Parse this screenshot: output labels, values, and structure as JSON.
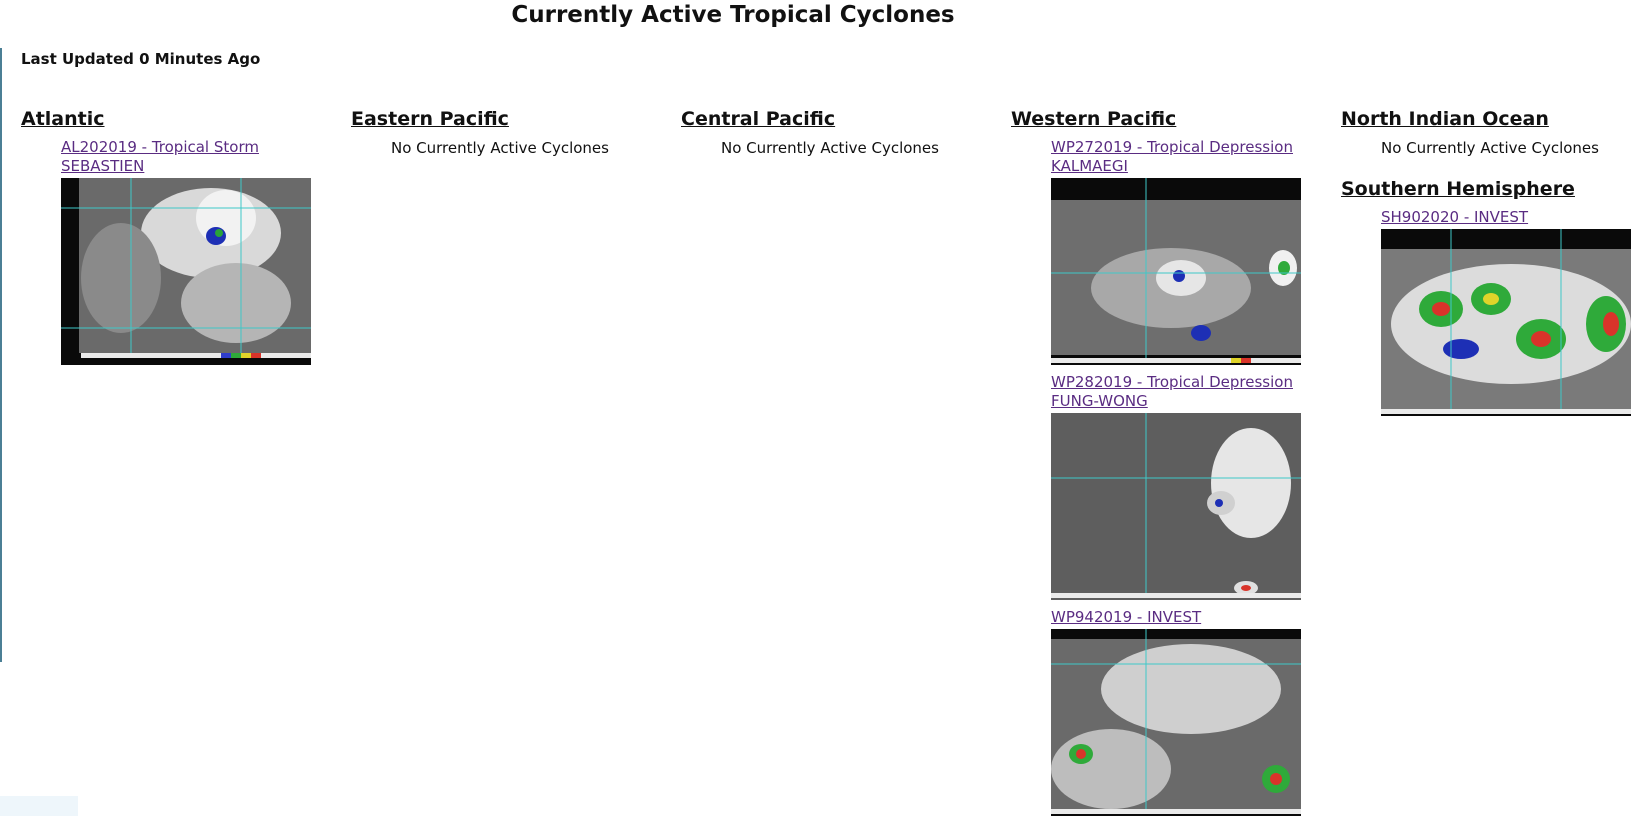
{
  "page": {
    "title": "Currently Active Tropical Cyclones",
    "last_updated": "Last Updated 0 Minutes Ago"
  },
  "regions": {
    "atlantic": {
      "heading": "Atlantic",
      "storms": [
        {
          "label": "AL202019 - Tropical Storm SEBASTIEN"
        }
      ]
    },
    "eastern_pacific": {
      "heading": "Eastern Pacific",
      "empty_message": "No Currently Active Cyclones"
    },
    "central_pacific": {
      "heading": "Central Pacific",
      "empty_message": "No Currently Active Cyclones"
    },
    "western_pacific": {
      "heading": "Western Pacific",
      "storms": [
        {
          "label": "WP272019 - Tropical Depression KALMAEGI"
        },
        {
          "label": "WP282019 - Tropical Depression FUNG-WONG"
        },
        {
          "label": "WP942019 - INVEST"
        }
      ]
    },
    "north_indian": {
      "heading": "North Indian Ocean",
      "empty_message": "No Currently Active Cyclones"
    },
    "southern_hemisphere": {
      "heading": "Southern Hemisphere",
      "storms": [
        {
          "label": "SH902020 - INVEST"
        }
      ]
    }
  },
  "colors": {
    "link": "#5a2c82",
    "rule": "#4b7f95",
    "sat_background": "#0b0b0b",
    "sat_cloud": "#bfbfbf",
    "sat_grid": "#3fc8c8"
  },
  "icons": {
    "satellite_image": "infrared-satellite-image"
  }
}
